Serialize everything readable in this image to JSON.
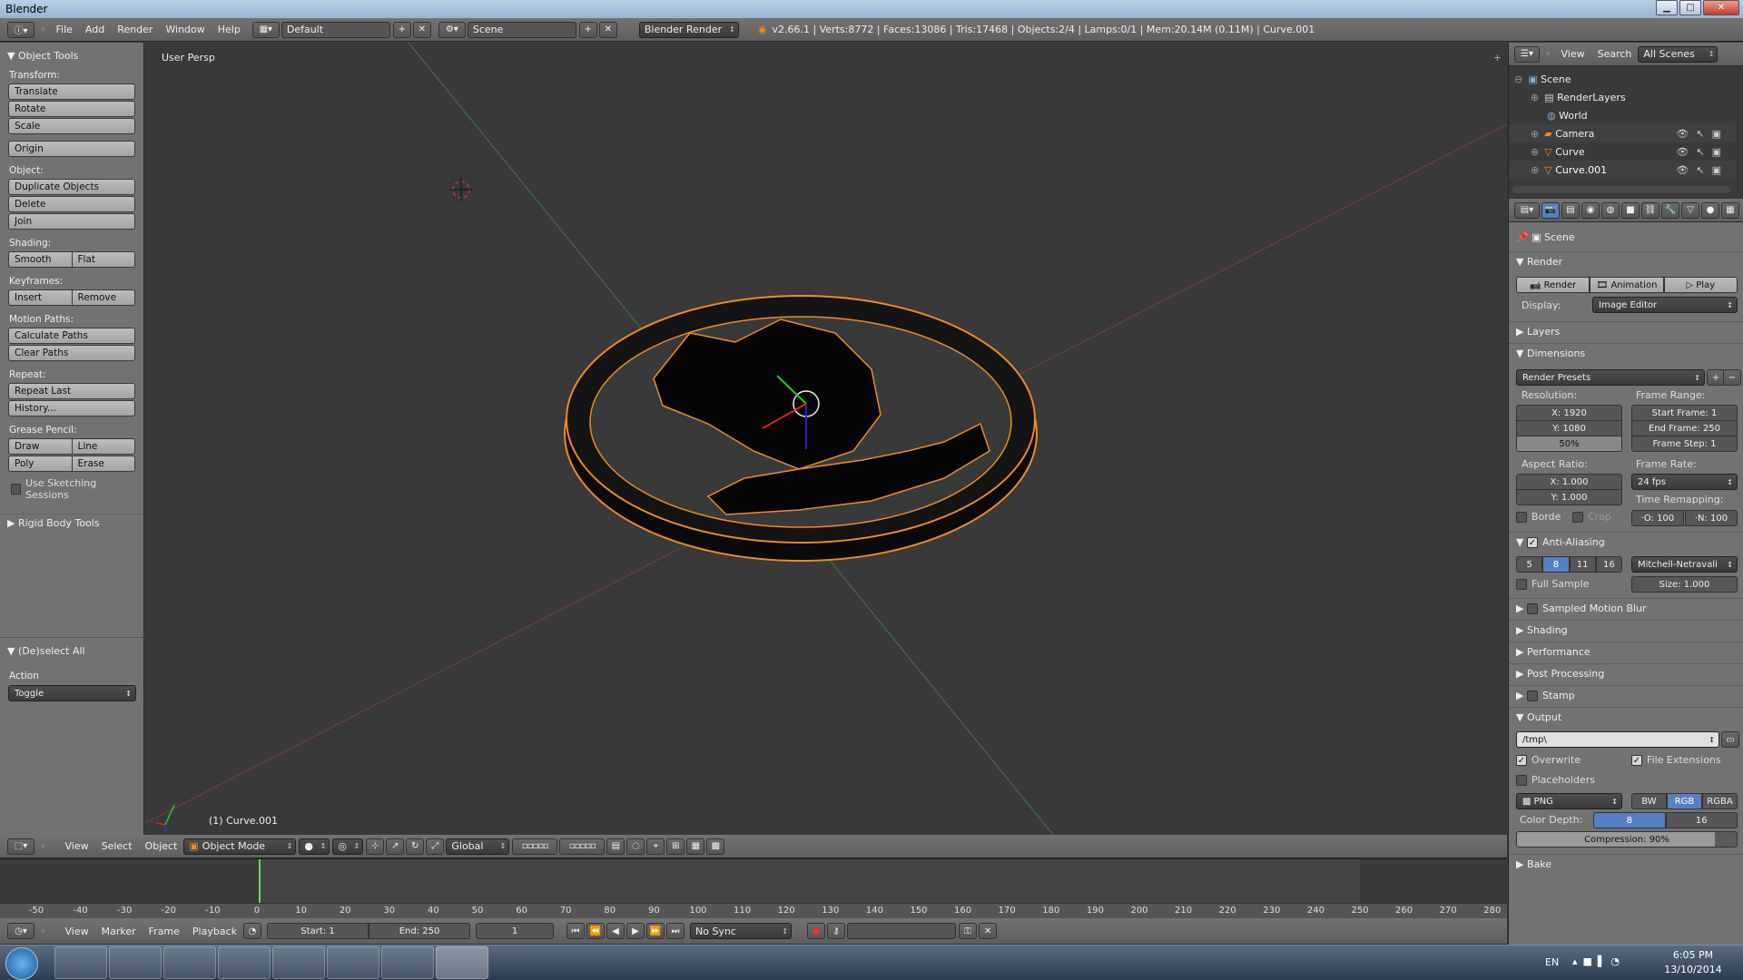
{
  "titlebar": {
    "title": "Blender",
    "min": "▁",
    "max": "□",
    "close": "✕"
  },
  "info_header": {
    "menus": [
      "File",
      "Add",
      "Render",
      "Window",
      "Help"
    ],
    "screen_layout": "Default",
    "scene": "Scene",
    "engine": "Blender Render",
    "stats": "v2.66.1 | Verts:8772 | Faces:13086 | Tris:17468 | Objects:2/4 | Lamps:0/1 | Mem:20.14M (0.11M) | Curve.001"
  },
  "tool_shelf": {
    "title": "Object Tools",
    "transform_label": "Transform:",
    "translate": "Translate",
    "rotate": "Rotate",
    "scale": "Scale",
    "origin": "Origin",
    "object_label": "Object:",
    "duplicate": "Duplicate Objects",
    "delete": "Delete",
    "join": "Join",
    "shading_label": "Shading:",
    "smooth": "Smooth",
    "flat": "Flat",
    "keyframes_label": "Keyframes:",
    "insert": "Insert",
    "remove": "Remove",
    "motion_label": "Motion Paths:",
    "calc_paths": "Calculate Paths",
    "clear_paths": "Clear Paths",
    "repeat_label": "Repeat:",
    "repeat_last": "Repeat Last",
    "history": "History...",
    "grease_label": "Grease Pencil:",
    "draw": "Draw",
    "line": "Line",
    "poly": "Poly",
    "erase": "Erase",
    "sketching": "Use Sketching Sessions",
    "rigid_body": "Rigid Body Tools",
    "operator_title": "(De)select All",
    "action_label": "Action",
    "action_value": "Toggle"
  },
  "viewport": {
    "view_name": "User Persp",
    "object_label": "(1) Curve.001"
  },
  "view3d_header": {
    "menus": [
      "View",
      "Select",
      "Object"
    ],
    "mode": "Object Mode",
    "orientation": "Global"
  },
  "outliner": {
    "menus": [
      "View",
      "Search"
    ],
    "filter": "All Scenes",
    "items": [
      "Scene",
      "RenderLayers",
      "World",
      "Camera",
      "Curve",
      "Curve.001"
    ]
  },
  "properties": {
    "context": "Scene",
    "render_panel": "Render",
    "render_btn": "Render",
    "animation_btn": "Animation",
    "play_btn": "Play",
    "display_label": "Display:",
    "display_value": "Image Editor",
    "layers": "Layers",
    "dimensions": "Dimensions",
    "render_presets": "Render Presets",
    "resolution_label": "Resolution:",
    "res_x": "X: 1920",
    "res_y": "Y: 1080",
    "res_pct": "50%",
    "frame_range_label": "Frame Range:",
    "start_frame": "Start Frame: 1",
    "end_frame": "End Frame: 250",
    "frame_step": "Frame Step: 1",
    "aspect_label": "Aspect Ratio:",
    "aspect_x": "X: 1.000",
    "aspect_y": "Y: 1.000",
    "frame_rate_label": "Frame Rate:",
    "frame_rate": "24 fps",
    "time_remap_label": "Time Remapping:",
    "remap_old": "·O: 100",
    "remap_new": "·N: 100",
    "border": "Borde",
    "crop": "Crop",
    "anti_aliasing": "Anti-Aliasing",
    "aa_samples": [
      "5",
      "8",
      "11",
      "16"
    ],
    "aa_filter": "Mitchell-Netravali",
    "full_sample": "Full Sample",
    "filter_size": "Size: 1.000",
    "sampled_blur": "Sampled Motion Blur",
    "shading": "Shading",
    "performance": "Performance",
    "post_processing": "Post Processing",
    "stamp": "Stamp",
    "output": "Output",
    "output_path": "/tmp\\",
    "overwrite": "Overwrite",
    "file_extensions": "File Extensions",
    "placeholders": "Placeholders",
    "format": "PNG",
    "bw": "BW",
    "rgb": "RGB",
    "rgba": "RGBA",
    "color_depth_label": "Color Depth:",
    "depth_8": "8",
    "depth_16": "16",
    "compression": "Compression: 90%",
    "bake": "Bake"
  },
  "timeline": {
    "ticks": [
      "-50",
      "-40",
      "-30",
      "-20",
      "-10",
      "0",
      "10",
      "20",
      "30",
      "40",
      "50",
      "60",
      "70",
      "80",
      "90",
      "100",
      "110",
      "120",
      "130",
      "140",
      "150",
      "160",
      "170",
      "180",
      "190",
      "200",
      "210",
      "220",
      "230",
      "240",
      "250",
      "260",
      "270",
      "280"
    ],
    "menus": [
      "View",
      "Marker",
      "Frame",
      "Playback"
    ],
    "start": "Start: 1",
    "end": "End: 250",
    "current": "1",
    "sync": "No Sync"
  },
  "taskbar": {
    "lang": "EN",
    "time": "6:05 PM",
    "date": "13/10/2014"
  },
  "colors": {
    "accent": "#5680c2",
    "selected_orange": "#f08a24",
    "viewport_bg": "#393939"
  }
}
